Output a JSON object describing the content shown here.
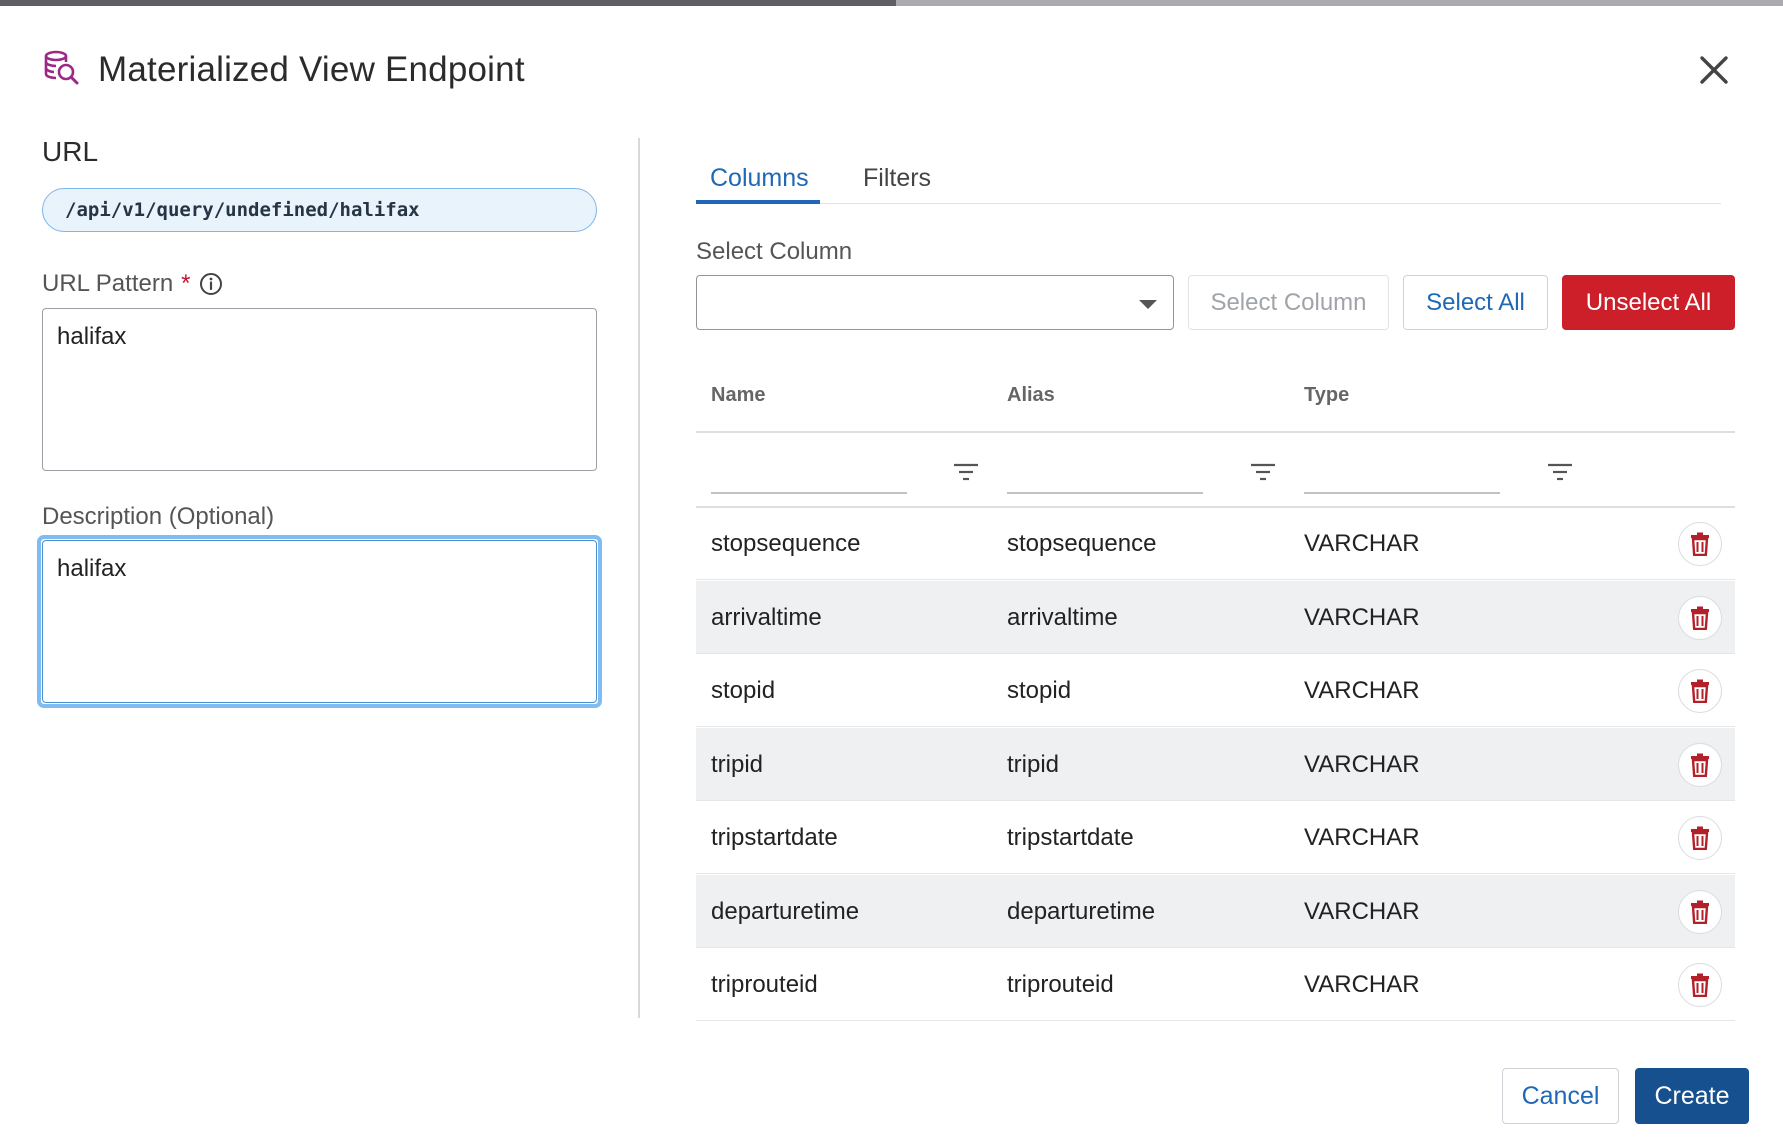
{
  "dialog": {
    "title": "Materialized View Endpoint",
    "icon": "database-search-icon",
    "accent_color": "#9b2a86"
  },
  "form": {
    "url_label": "URL",
    "url_value": "/api/v1/query/undefined/halifax",
    "url_pattern_label": "URL Pattern",
    "required_mark": "*",
    "url_pattern_value": "halifax",
    "description_label": "Description (Optional)",
    "description_value": "halifax"
  },
  "tabs": [
    {
      "label": "Columns",
      "active": true
    },
    {
      "label": "Filters",
      "active": false
    }
  ],
  "column_picker": {
    "label": "Select Column",
    "selected_value": "",
    "select_column_button": "Select Column",
    "select_all_button": "Select All",
    "unselect_all_button": "Unselect All"
  },
  "table": {
    "headers": [
      "Name",
      "Alias",
      "Type"
    ],
    "rows": [
      {
        "name": "stopsequence",
        "alias": "stopsequence",
        "type": "VARCHAR"
      },
      {
        "name": "arrivaltime",
        "alias": "arrivaltime",
        "type": "VARCHAR"
      },
      {
        "name": "stopid",
        "alias": "stopid",
        "type": "VARCHAR"
      },
      {
        "name": "tripid",
        "alias": "tripid",
        "type": "VARCHAR"
      },
      {
        "name": "tripstartdate",
        "alias": "tripstartdate",
        "type": "VARCHAR"
      },
      {
        "name": "departuretime",
        "alias": "departuretime",
        "type": "VARCHAR"
      },
      {
        "name": "triprouteid",
        "alias": "triprouteid",
        "type": "VARCHAR"
      }
    ]
  },
  "footer": {
    "cancel_label": "Cancel",
    "create_label": "Create"
  },
  "colors": {
    "primary": "#17508f",
    "link": "#1f68b5",
    "danger": "#cc1f2a",
    "delete_icon": "#b3202a"
  }
}
